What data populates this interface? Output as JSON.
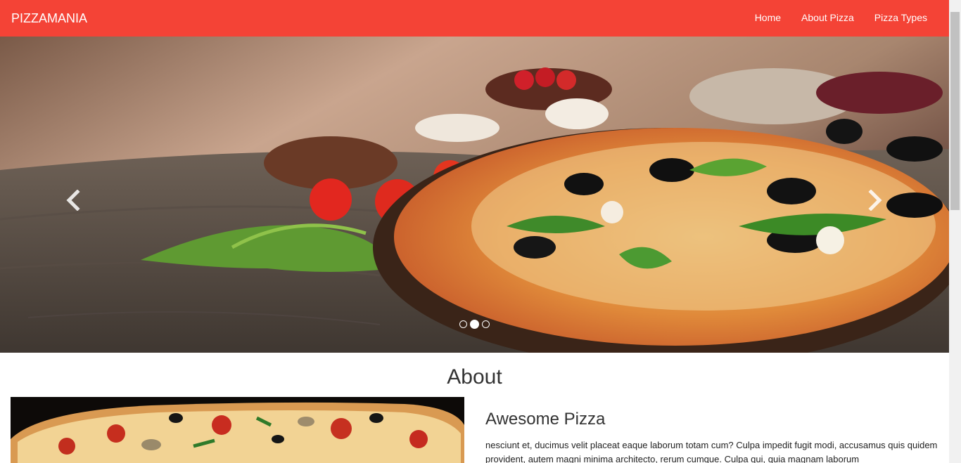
{
  "navbar": {
    "brand": "PIZZAMANIA",
    "links": [
      "Home",
      "About Pizza",
      "Pizza Types"
    ],
    "bg_color": "#f44336"
  },
  "carousel": {
    "slide_count": 3,
    "active_index": 1,
    "prev_icon": "chevron-left-icon",
    "next_icon": "chevron-right-icon"
  },
  "about": {
    "title": "About",
    "subtitle": "Awesome Pizza",
    "paragraph": "nesciunt et, ducimus velit placeat eaque laborum totam cum? Culpa impedit fugit modi, accusamus quis quidem provident, autem magni minima architecto, rerum cumque. Culpa qui, quia magnam laborum"
  }
}
